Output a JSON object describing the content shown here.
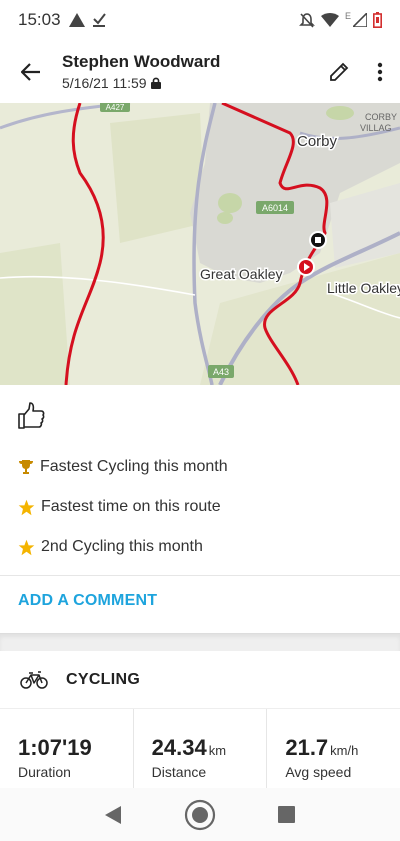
{
  "status_bar": {
    "time": "15:03",
    "left_icons": [
      "warning-triangle-icon",
      "download-done-icon"
    ],
    "right_icons": [
      "notifications-off-icon",
      "wifi-icon",
      "cell-signal-icon",
      "battery-low-icon"
    ],
    "signal_label": "E"
  },
  "header": {
    "title": "Stephen Woodward",
    "subtitle": "5/16/21 11:59",
    "back_icon": "arrow-back-icon",
    "edit_icon": "pencil-icon",
    "more_icon": "more-vert-icon"
  },
  "map": {
    "places": [
      "Corby",
      "CORBY",
      "VILLAG",
      "Great Oakley",
      "Little Oakley"
    ],
    "roads": [
      "A427",
      "A6014",
      "A43"
    ],
    "route_color": "#d50f1f",
    "land_color": "#e8ead7"
  },
  "feed": {
    "like_icon": "thumbs-up-icon",
    "achievements": [
      {
        "icon": "trophy-icon",
        "color": "#c78a00",
        "text": "Fastest Cycling this month"
      },
      {
        "icon": "star-icon",
        "color": "#f4b400",
        "text": "Fastest time on this route"
      },
      {
        "icon": "star-icon",
        "color": "#f4b400",
        "text": "2nd Cycling this month"
      }
    ],
    "comment_label": "ADD A COMMENT",
    "accent_color": "#1ea4dd"
  },
  "workout": {
    "sport_icon": "bicycle-icon",
    "sport_label": "CYCLING",
    "stats": [
      {
        "value": "1:07'19",
        "unit": "",
        "caption": "Duration"
      },
      {
        "value": "24.34",
        "unit": "km",
        "caption": "Distance"
      },
      {
        "value": "21.7",
        "unit": "km/h",
        "caption": "Avg speed"
      }
    ]
  },
  "nav_bar": {
    "back_icon": "nav-back-icon",
    "home_icon": "nav-home-icon",
    "recents_icon": "nav-recents-icon"
  }
}
